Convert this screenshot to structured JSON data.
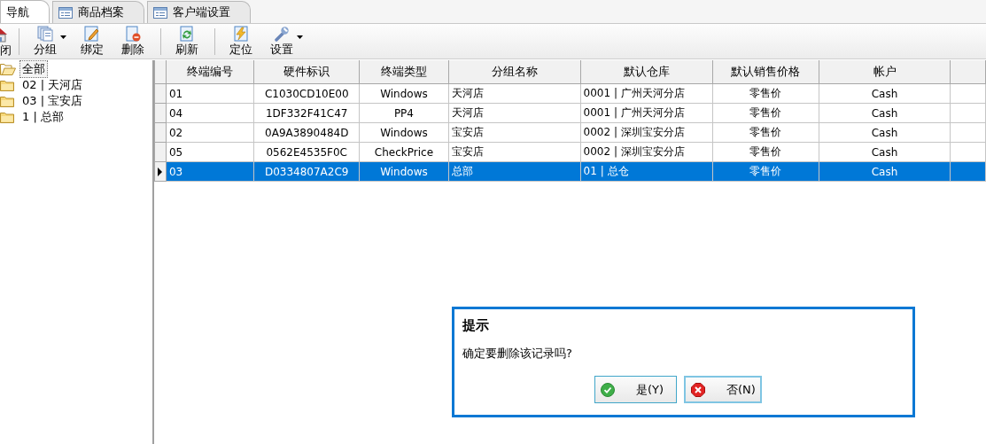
{
  "tabs": [
    {
      "label": "导航",
      "selected": true,
      "icon": false
    },
    {
      "label": "商品档案",
      "selected": false,
      "icon": true
    },
    {
      "label": "客户端设置",
      "selected": false,
      "icon": true
    }
  ],
  "toolbar": [
    {
      "label": "闭",
      "kind": "close",
      "dropdown": false
    },
    {
      "kind": "separator"
    },
    {
      "label": "分组",
      "kind": "group",
      "dropdown": true
    },
    {
      "label": "绑定",
      "kind": "bind",
      "dropdown": false
    },
    {
      "label": "删除",
      "kind": "delete",
      "dropdown": false
    },
    {
      "kind": "separator"
    },
    {
      "label": "刷新",
      "kind": "refresh",
      "dropdown": false
    },
    {
      "kind": "separator"
    },
    {
      "label": "定位",
      "kind": "locate",
      "dropdown": false
    },
    {
      "label": "设置",
      "kind": "settings",
      "dropdown": true
    }
  ],
  "tree": [
    {
      "label": "全部",
      "expanded": true,
      "selected": true,
      "children": [
        {
          "label": "02 | 天河店",
          "selected": false
        },
        {
          "label": "03 | 宝安店",
          "selected": false
        },
        {
          "label": "1 | 总部",
          "selected": false
        }
      ]
    }
  ],
  "table": {
    "columns": [
      "终端编号",
      "硬件标识",
      "终端类型",
      "分组名称",
      "默认仓库",
      "默认销售价格",
      "帐户"
    ],
    "rows": [
      {
        "cells": [
          "01",
          "C1030CD10E00",
          "Windows",
          "天河店",
          "0001 | 广州天河分店",
          "零售价",
          "Cash"
        ],
        "selected": false
      },
      {
        "cells": [
          "04",
          "1DF332F41C47",
          "PP4",
          "天河店",
          "0001 | 广州天河分店",
          "零售价",
          "Cash"
        ],
        "selected": false
      },
      {
        "cells": [
          "02",
          "0A9A3890484D",
          "Windows",
          "宝安店",
          "0002 | 深圳宝安分店",
          "零售价",
          "Cash"
        ],
        "selected": false
      },
      {
        "cells": [
          "05",
          "0562E4535F0C",
          "CheckPrice",
          "宝安店",
          "0002 | 深圳宝安分店",
          "零售价",
          "Cash"
        ],
        "selected": false
      },
      {
        "cells": [
          "03",
          "D0334807A2C9",
          "Windows",
          "总部",
          "01 | 总仓",
          "零售价",
          "Cash"
        ],
        "selected": true
      }
    ]
  },
  "dialog": {
    "title": "提示",
    "message": "确定要删除该记录吗?",
    "buttons": [
      {
        "label": "是(Y)",
        "kind": "yes",
        "focused": false
      },
      {
        "label": "否(N)",
        "kind": "no",
        "focused": true
      }
    ]
  }
}
